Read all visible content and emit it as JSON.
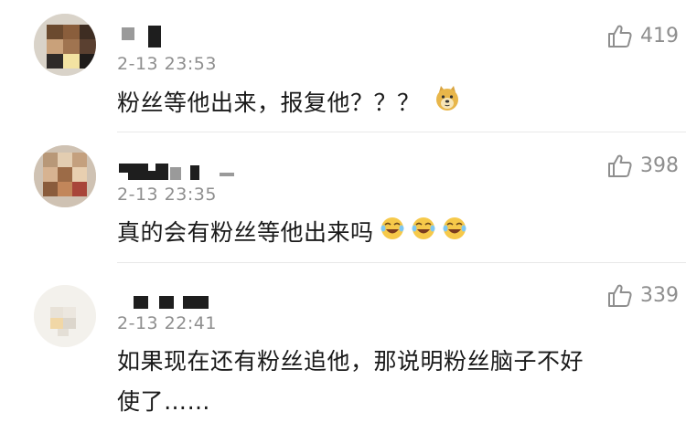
{
  "comments": [
    {
      "timestamp": "2-13 23:53",
      "likes": "419",
      "text": "粉丝等他出来，报复他？？？",
      "emoji": [
        "doge-emoji"
      ]
    },
    {
      "timestamp": "2-13 23:35",
      "likes": "398",
      "text": "真的会有粉丝等他出来吗",
      "emoji": [
        "laugh-cry-emoji",
        "laugh-cry-emoji",
        "laugh-cry-emoji"
      ]
    },
    {
      "timestamp": "2-13 22:41",
      "likes": "339",
      "text_line1": "如果现在还有粉丝追他，那说明粉丝脑子不好",
      "text_line2": "使了……"
    }
  ],
  "colors": {
    "meta_grey": "#8e8e8e",
    "text": "#1a1a1a",
    "divider": "#e8e8e8"
  }
}
